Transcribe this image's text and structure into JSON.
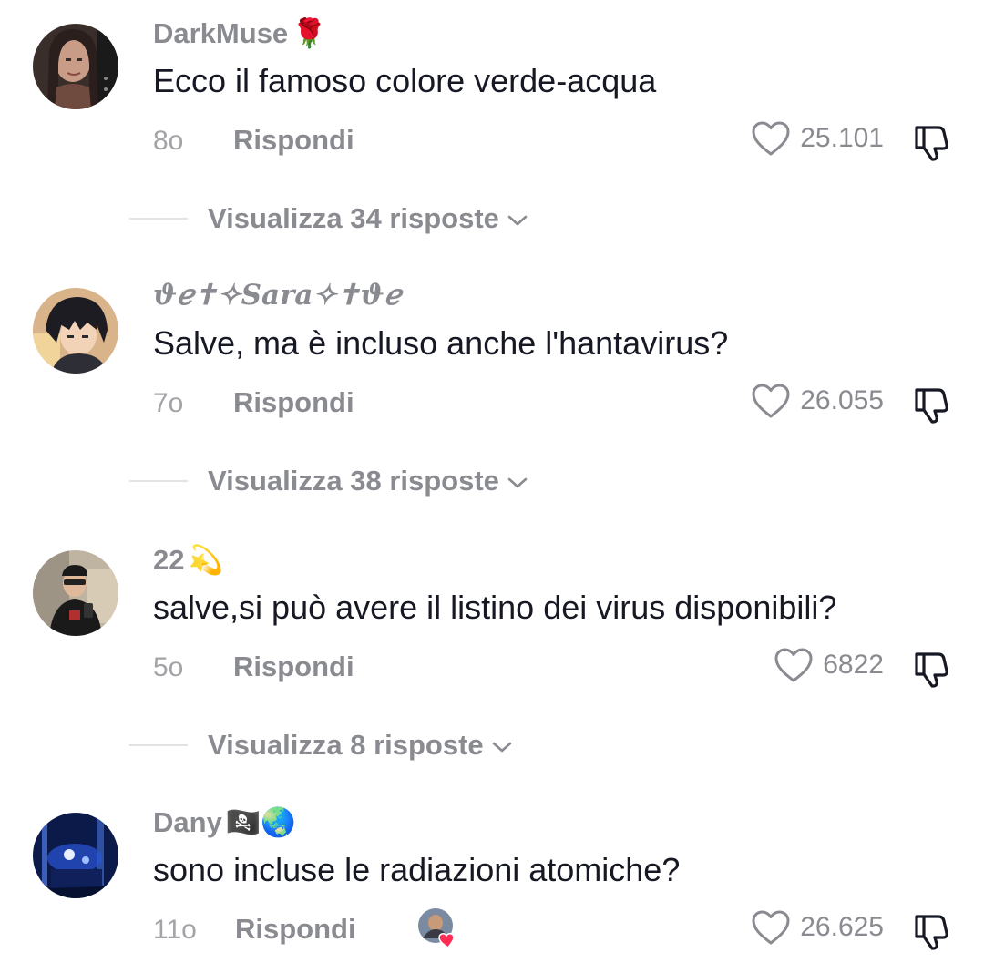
{
  "comments": [
    {
      "username": "DarkMuse",
      "username_emoji": "🌹",
      "text": "Ecco il famoso colore verde-acqua",
      "time": "8o",
      "reply_label": "Rispondi",
      "likes": "25.101",
      "view_replies": "Visualizza 34 risposte"
    },
    {
      "username": "ϑℯ✝✧𝑺𝒂𝒓𝒂✧✝ϑℯ",
      "username_emoji": "",
      "text": "Salve, ma è incluso anche l'hantavirus?",
      "time": "7o",
      "reply_label": "Rispondi",
      "likes": "26.055",
      "view_replies": "Visualizza 38 risposte"
    },
    {
      "username": "22",
      "username_emoji": "💫",
      "text": "salve,si può avere il listino dei virus disponibili?",
      "time": "5o",
      "reply_label": "Rispondi",
      "likes": "6822",
      "view_replies": "Visualizza 8 risposte"
    },
    {
      "username": "Dany",
      "username_emoji": "🏴‍☠️🌏",
      "text": "sono incluse le radiazioni atomiche?",
      "time": "11o",
      "reply_label": "Rispondi",
      "likes": "26.625",
      "view_replies": ""
    }
  ],
  "icons": {
    "like": "heart-outline-icon",
    "dislike": "thumbs-down-icon",
    "expand": "chevron-down-icon",
    "creator_liked": "creator-liked-badge"
  },
  "colors": {
    "text": "#161823",
    "secondary": "#8a8b91",
    "heart_badge": "#fe2c55"
  }
}
